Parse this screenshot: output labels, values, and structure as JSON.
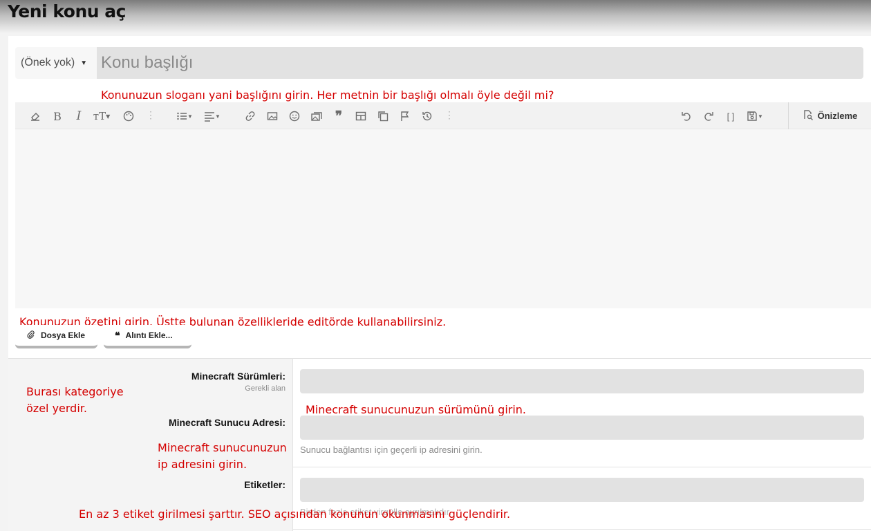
{
  "header": {
    "title": "Yeni konu aç"
  },
  "title_row": {
    "prefix_label": "(Önek yok)",
    "title_placeholder": "Konu başlığı"
  },
  "annotations": {
    "title_note": "Konunuzun sloganı yani başlığını girin. Her metnin bir başlığı olmalı öyle değil mi?",
    "editor_note": "Konunuzun özetini girin. Üstte bulunan özellikleride editörde kullanabilirsiniz.",
    "category_note_1": "Burası kategoriye",
    "category_note_2": "özel yerdir.",
    "version_note": "Minecraft sunucunuzun sürümünü girin.",
    "ip_note_1": "Minecraft sunucunuzun",
    "ip_note_2": "ip adresini girin.",
    "tags_note": "En az 3 etiket girilmesi şarttır. SEO açısından konunun okunmasını güçlendirir."
  },
  "editor": {
    "toolbar_icons": [
      "eraser-icon",
      "bold-icon",
      "italic-icon",
      "font-size-icon",
      "palette-icon",
      "more-icon",
      "list-icon",
      "align-icon",
      "link-icon",
      "image-icon",
      "smiley-icon",
      "media-icon",
      "quote-icon",
      "table-icon",
      "copy-icon",
      "flag-icon",
      "history-icon",
      "more-icon",
      "undo-icon",
      "redo-icon",
      "bbcode-icon",
      "save-draft-icon",
      "preview-icon"
    ],
    "preview_label": "Önizleme"
  },
  "attachments": {
    "file_label": "Dosya Ekle",
    "quote_label": "Alıntı Ekle..."
  },
  "fields": {
    "versions": {
      "label": "Minecraft Sürümleri:",
      "required": "Gerekli alan"
    },
    "address": {
      "label": "Minecraft Sunucu Adresi:",
      "explain": "Sunucu bağlantısı için geçerli ip adresini girin."
    },
    "tags": {
      "label": "Etiketler:",
      "explain": "Birden fazla etiket virgülle ayrılmalıdır."
    }
  },
  "colors": {
    "annotation": "#d40000",
    "input_bg": "#e2e2e2"
  }
}
